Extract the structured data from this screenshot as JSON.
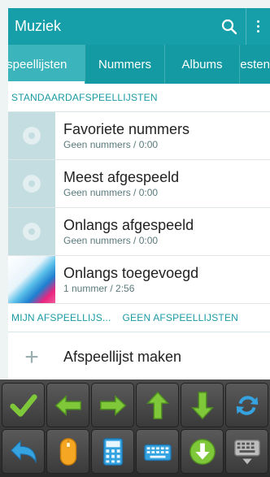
{
  "appbar": {
    "title": "Muziek"
  },
  "tabs": [
    {
      "label": "Afspeellijsten",
      "active": true
    },
    {
      "label": "Nummers"
    },
    {
      "label": "Albums"
    },
    {
      "label": "Artiesten"
    }
  ],
  "sections": {
    "standard_header": "STANDAARDAFSPEELLIJSTEN",
    "my_header": "MIJN AFSPEELLIJS...",
    "my_header_right": "GEEN AFSPEELLIJSTEN"
  },
  "standard_playlists": [
    {
      "title": "Favoriete nummers",
      "sub": "Geen nummers / 0:00"
    },
    {
      "title": "Meest afgespeeld",
      "sub": "Geen nummers / 0:00"
    },
    {
      "title": "Onlangs afgespeeld",
      "sub": "Geen nummers / 0:00"
    },
    {
      "title": "Onlangs toegevoegd",
      "sub": "1 nummer / 2:56"
    }
  ],
  "add_playlist": {
    "label": "Afspeellijst maken"
  },
  "colors": {
    "accent": "#169fa8",
    "tab_active": "#3cb4bc",
    "toolbar": "#3a3a3a"
  },
  "toolbar_row1": [
    "check-icon",
    "arrow-left-icon",
    "arrow-right-icon",
    "arrow-up-icon",
    "arrow-down-icon",
    "refresh-icon"
  ],
  "toolbar_row2": [
    "undo-icon",
    "mouse-icon",
    "calculator-icon",
    "keyboard-icon",
    "download-icon",
    "keyboard-down-icon"
  ]
}
